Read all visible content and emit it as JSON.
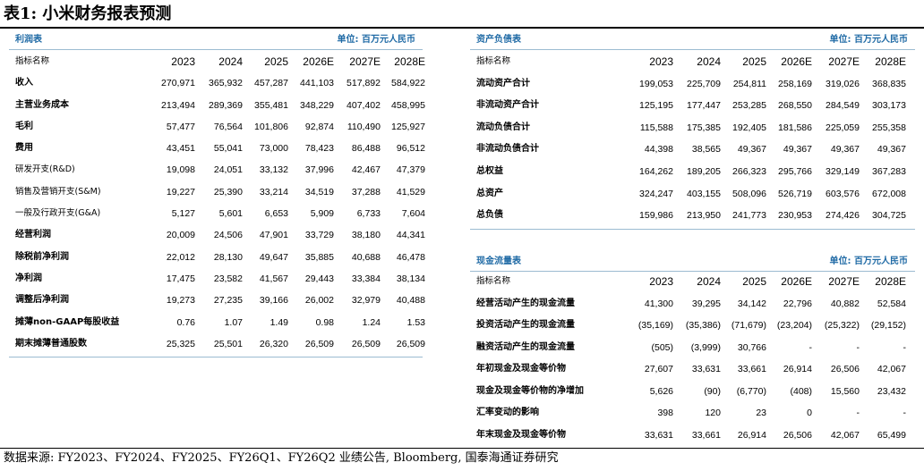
{
  "title": "表1:  小米财务报表预测",
  "years": [
    "2023",
    "2024",
    "2025",
    "2026E",
    "2027E",
    "2028E"
  ],
  "income": {
    "name": "利润表",
    "unit": "单位: 百万元人民币",
    "header_label": "指标名称",
    "rows": [
      {
        "label": "收入",
        "values": [
          "270,971",
          "365,932",
          "457,287",
          "441,103",
          "517,892",
          "584,922"
        ]
      },
      {
        "label": "主营业务成本",
        "values": [
          "213,494",
          "289,369",
          "355,481",
          "348,229",
          "407,402",
          "458,995"
        ]
      },
      {
        "label": "毛利",
        "values": [
          "57,477",
          "76,564",
          "101,806",
          "92,874",
          "110,490",
          "125,927"
        ]
      },
      {
        "label": "费用",
        "values": [
          "43,451",
          "55,041",
          "73,000",
          "78,423",
          "86,488",
          "96,512"
        ]
      },
      {
        "label": "研发开支(R&D)",
        "light": true,
        "values": [
          "19,098",
          "24,051",
          "33,132",
          "37,996",
          "42,467",
          "47,379"
        ]
      },
      {
        "label": "销售及营销开支(S&M)",
        "light": true,
        "values": [
          "19,227",
          "25,390",
          "33,214",
          "34,519",
          "37,288",
          "41,529"
        ]
      },
      {
        "label": "一般及行政开支(G&A)",
        "light": true,
        "values": [
          "5,127",
          "5,601",
          "6,653",
          "5,909",
          "6,733",
          "7,604"
        ]
      },
      {
        "label": "经营利润",
        "values": [
          "20,009",
          "24,506",
          "47,901",
          "33,729",
          "38,180",
          "44,341"
        ]
      },
      {
        "label": "除税前净利润",
        "values": [
          "22,012",
          "28,130",
          "49,647",
          "35,885",
          "40,688",
          "46,478"
        ]
      },
      {
        "label": "净利润",
        "values": [
          "17,475",
          "23,582",
          "41,567",
          "29,443",
          "33,384",
          "38,134"
        ]
      },
      {
        "label": "调整后净利润",
        "values": [
          "19,273",
          "27,235",
          "39,166",
          "26,002",
          "32,979",
          "40,488"
        ]
      },
      {
        "label": "摊薄non-GAAP每股收益",
        "values": [
          "0.76",
          "1.07",
          "1.49",
          "0.98",
          "1.24",
          "1.53"
        ]
      },
      {
        "label": "期末摊薄普通股数",
        "values": [
          "25,325",
          "25,501",
          "26,320",
          "26,509",
          "26,509",
          "26,509"
        ]
      }
    ]
  },
  "balance": {
    "name": "资产负债表",
    "unit": "单位: 百万元人民币",
    "header_label": "指标名称",
    "rows": [
      {
        "label": "流动资产合计",
        "values": [
          "199,053",
          "225,709",
          "254,811",
          "258,169",
          "319,026",
          "368,835"
        ]
      },
      {
        "label": "非流动资产合计",
        "values": [
          "125,195",
          "177,447",
          "253,285",
          "268,550",
          "284,549",
          "303,173"
        ]
      },
      {
        "label": "流动负债合计",
        "values": [
          "115,588",
          "175,385",
          "192,405",
          "181,586",
          "225,059",
          "255,358"
        ]
      },
      {
        "label": "非流动负债合计",
        "values": [
          "44,398",
          "38,565",
          "49,367",
          "49,367",
          "49,367",
          "49,367"
        ]
      },
      {
        "label": "总权益",
        "values": [
          "164,262",
          "189,205",
          "266,323",
          "295,766",
          "329,149",
          "367,283"
        ]
      },
      {
        "label": "总资产",
        "values": [
          "324,247",
          "403,155",
          "508,096",
          "526,719",
          "603,576",
          "672,008"
        ]
      },
      {
        "label": "总负债",
        "values": [
          "159,986",
          "213,950",
          "241,773",
          "230,953",
          "274,426",
          "304,725"
        ]
      }
    ]
  },
  "cashflow": {
    "name": "现金流量表",
    "unit": "单位: 百万元人民币",
    "header_label": "指标名称",
    "rows": [
      {
        "label": "经营活动产生的现金流量",
        "values": [
          "41,300",
          "39,295",
          "34,142",
          "22,796",
          "40,882",
          "52,584"
        ]
      },
      {
        "label": "投资活动产生的现金流量",
        "values": [
          "(35,169)",
          "(35,386)",
          "(71,679)",
          "(23,204)",
          "(25,322)",
          "(29,152)"
        ]
      },
      {
        "label": "融资活动产生的现金流量",
        "values": [
          "(505)",
          "(3,999)",
          "30,766",
          "-",
          "-",
          "-"
        ]
      },
      {
        "label": "年初现金及现金等价物",
        "values": [
          "27,607",
          "33,631",
          "33,661",
          "26,914",
          "26,506",
          "42,067"
        ]
      },
      {
        "label": "现金及现金等价物的净增加",
        "values": [
          "5,626",
          "(90)",
          "(6,770)",
          "(408)",
          "15,560",
          "23,432"
        ]
      },
      {
        "label": "汇率变动的影响",
        "values": [
          "398",
          "120",
          "23",
          "0",
          "-",
          "-"
        ]
      },
      {
        "label": "年末现金及现金等价物",
        "values": [
          "33,631",
          "33,661",
          "26,914",
          "26,506",
          "42,067",
          "65,499"
        ]
      }
    ]
  },
  "source": "数据来源: FY2023、FY2024、FY2025、FY26Q1、FY26Q2 业绩公告, Bloomberg, 国泰海通证券研究"
}
